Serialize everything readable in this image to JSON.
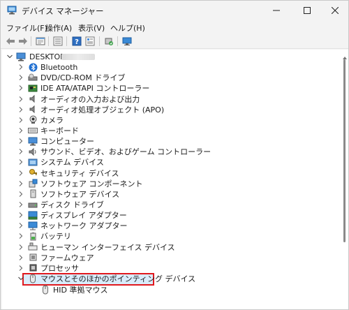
{
  "window": {
    "title": "デバイス マネージャー"
  },
  "menu": [
    "ファイル(F)",
    "操作(A)",
    "表示(V)",
    "ヘルプ(H)"
  ],
  "toolbar": {
    "buttons": [
      "back-icon",
      "forward-icon",
      "properties-icon",
      "list-icon",
      "help-icon",
      "details-icon",
      "update-driver-icon",
      "monitor-icon"
    ]
  },
  "tree": {
    "root": "DESKTOP-",
    "categories": [
      {
        "label": "Bluetooth",
        "icon": "bluetooth-icon"
      },
      {
        "label": "DVD/CD-ROM ドライブ",
        "icon": "dvd-drive-icon"
      },
      {
        "label": "IDE ATA/ATAPI コントローラー",
        "icon": "ide-controller-icon"
      },
      {
        "label": "オーディオの入力および出力",
        "icon": "audio-io-icon"
      },
      {
        "label": "オーディオ処理オブジェクト (APO)",
        "icon": "audio-apo-icon"
      },
      {
        "label": "カメラ",
        "icon": "camera-icon"
      },
      {
        "label": "キーボード",
        "icon": "keyboard-icon"
      },
      {
        "label": "コンピューター",
        "icon": "computer-icon"
      },
      {
        "label": "サウンド、ビデオ、およびゲーム コントローラー",
        "icon": "sound-icon"
      },
      {
        "label": "システム デバイス",
        "icon": "system-device-icon"
      },
      {
        "label": "セキュリティ デバイス",
        "icon": "security-device-icon"
      },
      {
        "label": "ソフトウェア コンポーネント",
        "icon": "software-component-icon"
      },
      {
        "label": "ソフトウェア デバイス",
        "icon": "software-device-icon"
      },
      {
        "label": "ディスク ドライブ",
        "icon": "disk-drive-icon"
      },
      {
        "label": "ディスプレイ アダプター",
        "icon": "display-adapter-icon"
      },
      {
        "label": "ネットワーク アダプター",
        "icon": "network-adapter-icon"
      },
      {
        "label": "バッテリ",
        "icon": "battery-icon"
      },
      {
        "label": "ヒューマン インターフェイス デバイス",
        "icon": "hid-icon"
      },
      {
        "label": "ファームウェア",
        "icon": "firmware-icon"
      },
      {
        "label": "プロセッサ",
        "icon": "processor-icon"
      },
      {
        "label": "マウスとそのほかのポインティング デバイス",
        "icon": "mouse-icon",
        "expanded": true,
        "selected": true
      }
    ],
    "children": [
      {
        "label": "HID 準拠マウス",
        "icon": "mouse-icon"
      }
    ]
  },
  "colors": {
    "highlight_border": "#e0191e",
    "selection_bg": "#d9ecfb"
  }
}
